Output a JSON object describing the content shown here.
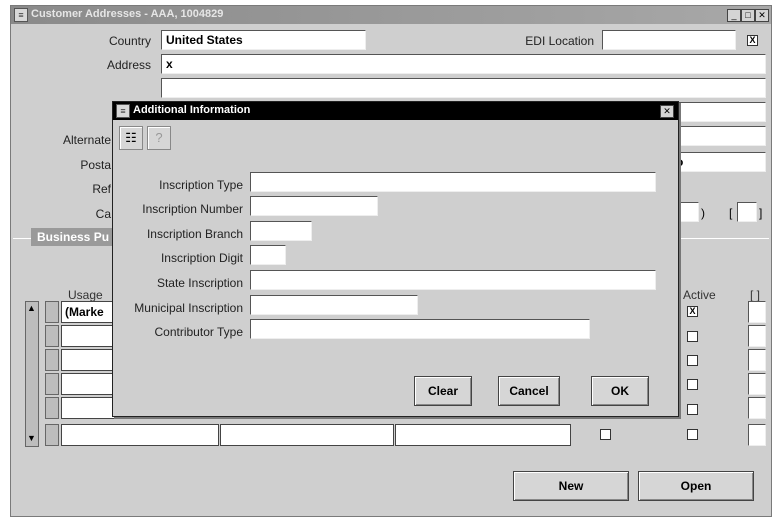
{
  "window": {
    "title": "Customer Addresses - AAA, 1004829"
  },
  "form": {
    "country_label": "Country",
    "country_value": "United States",
    "edi_label": "EDI Location",
    "edi_value": "",
    "address_label": "Address",
    "address_line1": "x",
    "alternate_label": "Alternate",
    "postal_label": "Posta",
    "ref_label": "Ref",
    "ca_label": "Ca",
    "right_partial": "o",
    "business_tab": "Business Pu"
  },
  "table": {
    "usage_header": "Usage",
    "active_header": "Active",
    "bracket_header": "[ ]",
    "first_row_usage": "(Marke",
    "rows": 6
  },
  "dialog": {
    "title": "Additional Information",
    "fields": [
      {
        "label": "Inscription Type",
        "value": ""
      },
      {
        "label": "Inscription Number",
        "value": ""
      },
      {
        "label": "Inscription Branch",
        "value": ""
      },
      {
        "label": "Inscription Digit",
        "value": ""
      },
      {
        "label": "State Inscription",
        "value": ""
      },
      {
        "label": "Municipal Inscription",
        "value": ""
      },
      {
        "label": "Contributor Type",
        "value": ""
      }
    ],
    "buttons": {
      "clear": "Clear",
      "cancel": "Cancel",
      "ok": "OK"
    }
  },
  "footer": {
    "new": "New",
    "open": "Open"
  },
  "checks": {
    "edi_checked": "X",
    "active_first": "X"
  }
}
